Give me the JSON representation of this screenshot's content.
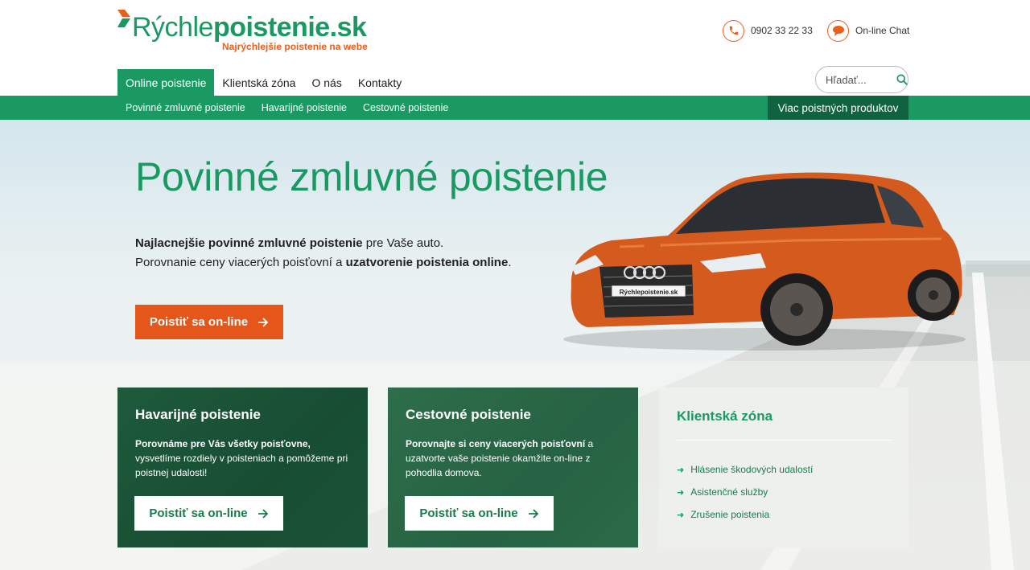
{
  "brand": {
    "logo_light": "Rýchle",
    "logo_bold": "poistenie.sk",
    "tagline": "Najrýchlejšie poistenie na webe",
    "green": "#1a9a62",
    "orange": "#e5561b"
  },
  "contact": {
    "phone": "0902 33 22 33",
    "phone_icon": "phone-icon",
    "chat": "On-line Chat",
    "chat_icon": "chat-bubble-icon"
  },
  "mainnav": {
    "items": [
      "Online poistenie",
      "Klientská zóna",
      "O nás",
      "Kontakty"
    ],
    "active_index": 0
  },
  "search": {
    "placeholder": "Hľadať...",
    "icon": "search-icon"
  },
  "subnav": {
    "items": [
      "Povinné zmluvné poistenie",
      "Havarijné poistenie",
      "Cestovné poistenie"
    ],
    "more": "Viac poistných produktov"
  },
  "hero": {
    "title": "Povinné zmluvné poistenie",
    "line1_bold": "Najlacnejšie povinné zmluvné poistenie",
    "line1_rest": " pre Vaše auto.",
    "line2_start": "Porovnanie ceny viacerých poisťovní a ",
    "line2_bold": "uzatvorenie poistenia online",
    "line2_end": ".",
    "cta": "Poistiť sa on-line",
    "plate": "Rýchlepoistenie.sk"
  },
  "cards": {
    "havarijne": {
      "title": "Havarijné poistenie",
      "text_bold": "Porovnáme pre Vás všetky poisťovne,",
      "text_rest": " vysvetlíme rozdiely v poisteniach a pomôžeme pri poistnej udalosti!",
      "button": "Poistiť sa on-line"
    },
    "cestovne": {
      "title": "Cestovné poistenie",
      "text_bold": "Porovnajte si ceny viacerých poisťovní",
      "text_rest": " a uzatvorte vaše poistenie okamžite on-line z pohodlia domova.",
      "button": "Poistiť sa on-line"
    },
    "klientska": {
      "title": "Klientská zóna",
      "links": [
        "Hlásenie škodových udalostí",
        "Asistenčné služby",
        "Zrušenie poistenia"
      ]
    }
  }
}
